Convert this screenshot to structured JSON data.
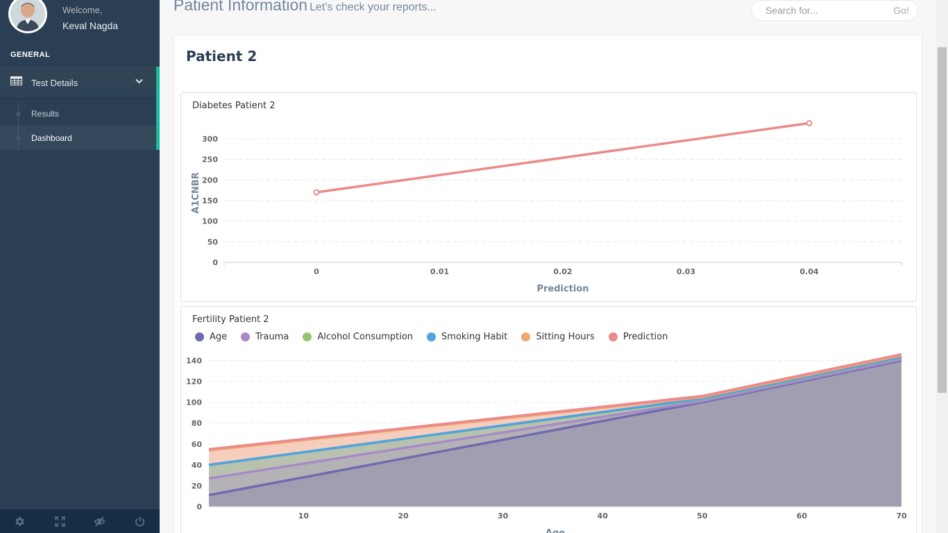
{
  "sidebar": {
    "welcome": "Welcome,",
    "username": "Keval Nagda",
    "section_title": "GENERAL",
    "menu": {
      "label": "Test Details",
      "icon": "table-icon",
      "expanded": true,
      "items": [
        {
          "label": "Results",
          "active": false
        },
        {
          "label": "Dashboard",
          "active": true
        }
      ]
    },
    "footer_icons": [
      "gear-icon",
      "fullscreen-icon",
      "eye-slash-icon",
      "power-icon"
    ]
  },
  "header": {
    "title": "Patient Information",
    "subtitle": "Let's check your reports...",
    "search_placeholder": "Search for...",
    "search_button": "Go!"
  },
  "panel": {
    "title": "Patient 2"
  },
  "colors": {
    "sidebar_bg": "#2a3f54",
    "accent": "#1ABB9C",
    "age": "#6E6BAE",
    "trauma": "#A889C9",
    "alcohol": "#96C46E",
    "smoking": "#4FA3E0",
    "sitting": "#F0A66C",
    "prediction": "#EB8A8A"
  },
  "chart_data": [
    {
      "type": "line",
      "title": "Diabetes Patient 2",
      "xlabel": "Prediction",
      "ylabel": "A1CNBR",
      "x_ticks": [
        "0",
        "0.01",
        "0.02",
        "0.03",
        "0.04"
      ],
      "y_ticks": [
        "0",
        "50",
        "100",
        "150",
        "200",
        "250",
        "300"
      ],
      "xlim": [
        0,
        0.04
      ],
      "ylim": [
        0,
        300
      ],
      "series": [
        {
          "x": [
            0,
            0.04
          ],
          "y": [
            170,
            338
          ],
          "color": "#EB8A8A"
        }
      ]
    },
    {
      "type": "area",
      "title": "Fertility Patient 2",
      "xlabel": "Age",
      "legend": [
        "Age",
        "Trauma",
        "Alcohol Consumption",
        "Smoking Habit",
        "Sitting Hours",
        "Prediction"
      ],
      "x_ticks": [
        "10",
        "20",
        "30",
        "40",
        "50",
        "60",
        "70"
      ],
      "y_ticks": [
        "0",
        "20",
        "40",
        "60",
        "80",
        "100",
        "120",
        "140"
      ],
      "xlim": [
        0.5,
        70
      ],
      "ylim": [
        0,
        145
      ],
      "stacked": true,
      "x": [
        0.5,
        50,
        70
      ],
      "series": [
        {
          "name": "Age",
          "color": "#6E6BAE",
          "values": [
            11,
            100,
            140
          ]
        },
        {
          "name": "Trauma",
          "color": "#A889C9",
          "values": [
            27,
            101,
            141
          ]
        },
        {
          "name": "Alcohol Consumption",
          "color": "#96C46E",
          "values": [
            40,
            103,
            143
          ]
        },
        {
          "name": "Smoking Habit",
          "color": "#4FA3E0",
          "values": [
            40,
            103.5,
            143.5
          ]
        },
        {
          "name": "Sitting Hours",
          "color": "#F0A66C",
          "values": [
            54,
            105,
            145
          ]
        },
        {
          "name": "Prediction",
          "color": "#EB8A8A",
          "values": [
            55,
            106,
            146
          ]
        }
      ]
    }
  ]
}
